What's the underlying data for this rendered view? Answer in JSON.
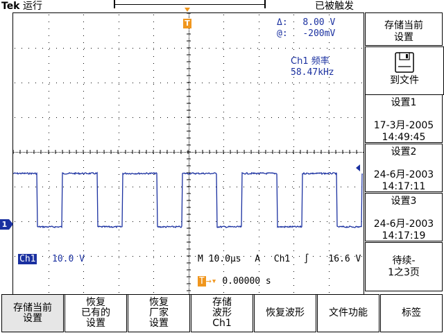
{
  "brand": {
    "name": "Tek",
    "state": "运行"
  },
  "trigger_status": "已被触发",
  "readout": {
    "delta_label": "Δ:",
    "delta_value": "8.00 V",
    "at_label": "@:",
    "at_value": "-200mV",
    "freq_label": "Ch1 频率",
    "freq_value": "58.47kHz"
  },
  "status_line": {
    "channel": "Ch1",
    "scale": "10.0 V",
    "timebase": "M 10.0μs",
    "trigger_mode": "A",
    "trigger_source": "Ch1",
    "trigger_level": "16.6 V",
    "position": "0.00000 s"
  },
  "markers": {
    "trigger_pos": "T",
    "ch1_ground": "1",
    "h_pos_label": "T"
  },
  "waveform": {
    "period_us": 17.1,
    "pulse_width_us": 10.0,
    "high_level_v": 8.0,
    "low_level_v": -0.2,
    "first_rise_us": 14.0,
    "color": "#1a30a0"
  },
  "side_menu": {
    "save_current": {
      "line1": "存储当前",
      "line2": "设置"
    },
    "to_file": {
      "label": "到文件",
      "icon": "floppy-disk-icon"
    },
    "setups": [
      {
        "label": "设置1",
        "date": "17-3月-2005",
        "time": "14:49:45"
      },
      {
        "label": "设置2",
        "date": "24-6月-2003",
        "time": "14:17:11"
      },
      {
        "label": "设置3",
        "date": "24-6月-2003",
        "time": "14:17:19"
      }
    ],
    "more": {
      "line1": "待续-",
      "line2": "1之3页"
    }
  },
  "bottom_menu": [
    {
      "lines": [
        "存储当前",
        "设置"
      ]
    },
    {
      "lines": [
        "恢复",
        "已有的",
        "设置"
      ]
    },
    {
      "lines": [
        "恢复",
        "厂家",
        "设置"
      ]
    },
    {
      "lines": [
        "存储",
        "波形",
        "Ch1"
      ]
    },
    {
      "lines": [
        "恢复波形"
      ]
    },
    {
      "lines": [
        "文件功能"
      ]
    },
    {
      "lines": [
        "标签"
      ]
    }
  ],
  "colors": {
    "trace": "#1a30a0",
    "trigger_marker": "#f0961e",
    "channel_marker": "#1a30a0",
    "grid": "#000000"
  }
}
